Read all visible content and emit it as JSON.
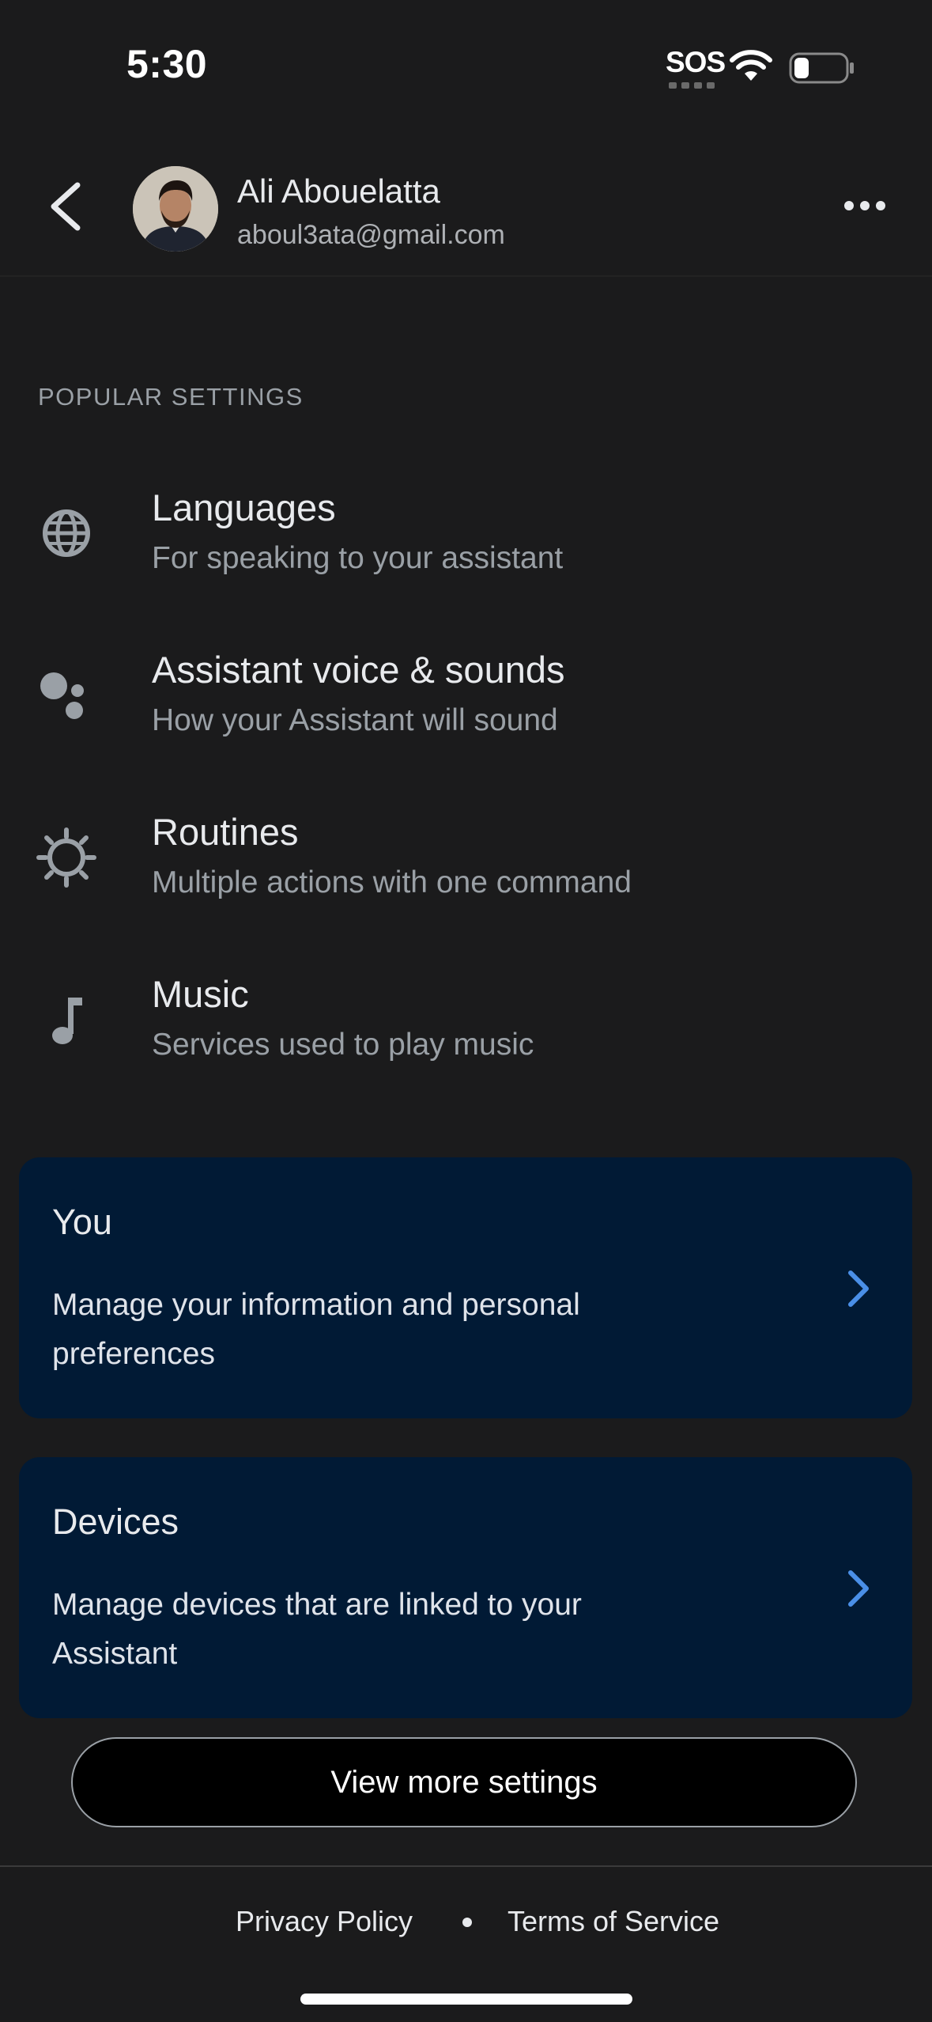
{
  "status_bar": {
    "time": "5:30",
    "sos": "SOS"
  },
  "account": {
    "name": "Ali Abouelatta",
    "email": "aboul3ata@gmail.com"
  },
  "section_title": "POPULAR SETTINGS",
  "settings": [
    {
      "title": "Languages",
      "subtitle": "For speaking to your assistant",
      "icon": "globe-icon"
    },
    {
      "title": "Assistant voice & sounds",
      "subtitle": "How your Assistant will sound",
      "icon": "assistant-dots-icon"
    },
    {
      "title": "Routines",
      "subtitle": "Multiple actions with one command",
      "icon": "routines-icon"
    },
    {
      "title": "Music",
      "subtitle": "Services used to play music",
      "icon": "music-note-icon"
    }
  ],
  "cards": [
    {
      "title": "You",
      "description": "Manage your information and personal preferences"
    },
    {
      "title": "Devices",
      "description": "Manage devices that are linked to your Assistant"
    }
  ],
  "view_more_label": "View more settings",
  "footer": {
    "privacy": "Privacy Policy",
    "terms": "Terms of Service"
  },
  "colors": {
    "background": "#1b1b1c",
    "card": "#011a35",
    "accent_chevron": "#4a8fe7"
  }
}
